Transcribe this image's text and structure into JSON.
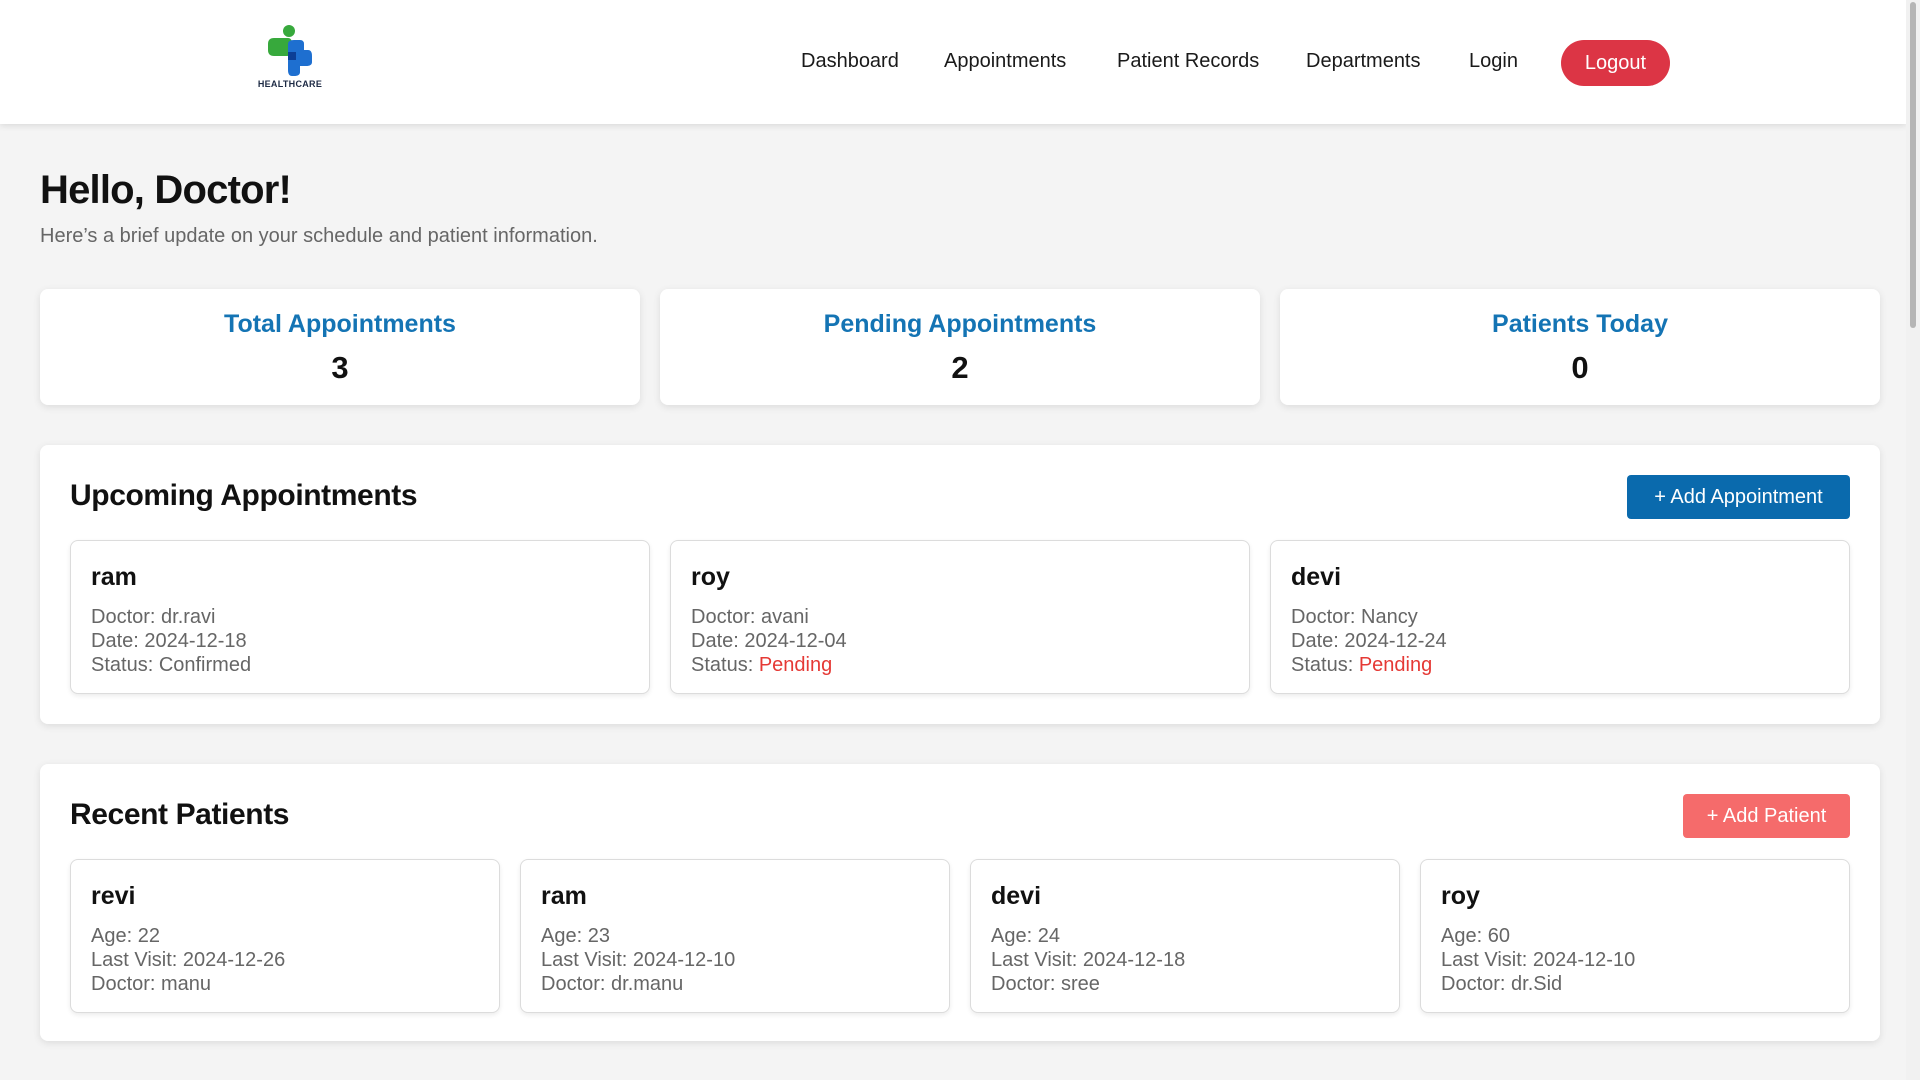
{
  "colors": {
    "accent": "#1474b4",
    "logout": "#dc3545",
    "add_patient": "#f56b6b",
    "add_appointment": "#0a6aad",
    "pending": "#e53935"
  },
  "header": {
    "logo_text": "HEALTHCARE",
    "logo_icon": "healthcare-cross-logo",
    "nav": [
      "Dashboard",
      "Appointments",
      "Patient Records",
      "Departments",
      "Login"
    ],
    "logout_label": "Logout"
  },
  "main": {
    "greeting": "Hello, Doctor!",
    "subtitle": "Here’s a brief update on your schedule and patient information."
  },
  "stats": [
    {
      "label": "Total Appointments",
      "value": "3"
    },
    {
      "label": "Pending Appointments",
      "value": "2"
    },
    {
      "label": "Patients Today",
      "value": "0"
    }
  ],
  "appointments": {
    "title": "Upcoming Appointments",
    "add_label": "+ Add Appointment",
    "items": [
      {
        "name": "ram",
        "doctor": "Doctor: dr.ravi",
        "date": "Date: 2024-12-18",
        "status_prefix": "Status: ",
        "status": "Confirmed"
      },
      {
        "name": "roy",
        "doctor": "Doctor: avani",
        "date": "Date: 2024-12-04",
        "status_prefix": "Status: ",
        "status": "Pending"
      },
      {
        "name": "devi",
        "doctor": "Doctor: Nancy",
        "date": "Date: 2024-12-24",
        "status_prefix": "Status: ",
        "status": "Pending"
      }
    ]
  },
  "patients": {
    "title": "Recent Patients",
    "add_label": "+ Add Patient",
    "items": [
      {
        "name": "revi",
        "age": "Age: 22",
        "last_visit": "Last Visit: 2024-12-26",
        "doctor": "Doctor: manu"
      },
      {
        "name": "ram",
        "age": "Age: 23",
        "last_visit": "Last Visit: 2024-12-10",
        "doctor": "Doctor: dr.manu"
      },
      {
        "name": "devi",
        "age": "Age: 24",
        "last_visit": "Last Visit: 2024-12-18",
        "doctor": "Doctor: sree"
      },
      {
        "name": "roy",
        "age": "Age: 60",
        "last_visit": "Last Visit: 2024-12-10",
        "doctor": "Doctor: dr.Sid"
      }
    ]
  }
}
